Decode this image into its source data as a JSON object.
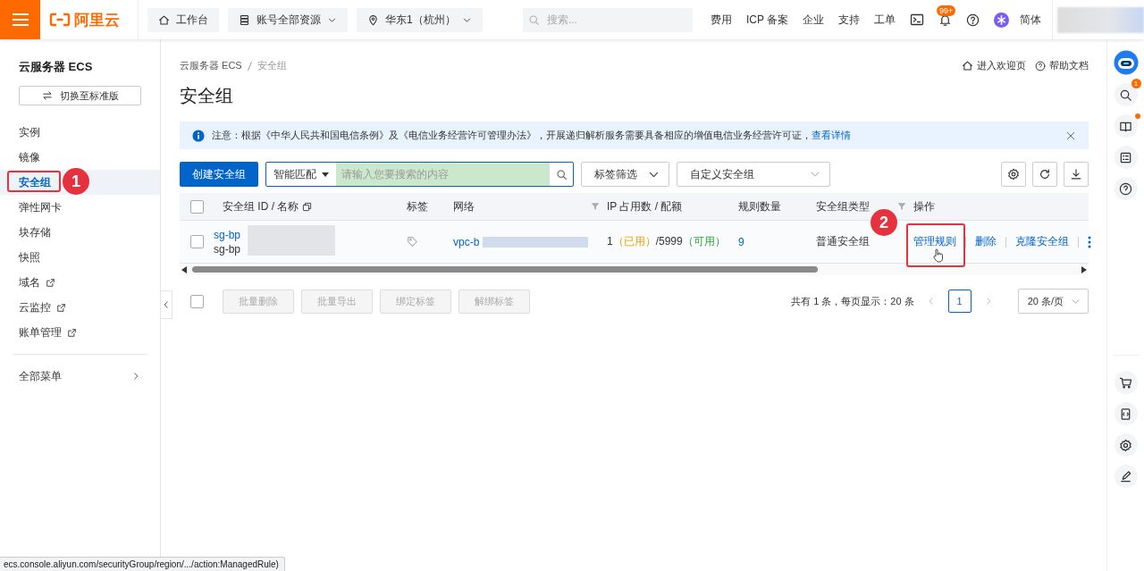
{
  "topbar": {
    "logo": "阿里云",
    "nav": [
      {
        "label": "工作台",
        "kind": "home"
      },
      {
        "label": "账号全部资源",
        "kind": "resources"
      },
      {
        "label": "华东1（杭州）",
        "kind": "region"
      }
    ],
    "search_placeholder": "搜索...",
    "links": [
      "费用",
      "ICP 备案",
      "企业",
      "支持",
      "工单"
    ],
    "notification_badge": "99+",
    "language": "简体"
  },
  "sidebar": {
    "title": "云服务器 ECS",
    "switch_button": "切换至标准版",
    "items": [
      {
        "label": "实例",
        "selected": false,
        "external": false
      },
      {
        "label": "镜像",
        "selected": false,
        "external": false
      },
      {
        "label": "安全组",
        "selected": true,
        "external": false,
        "callout": "1"
      },
      {
        "label": "弹性网卡",
        "selected": false,
        "external": false
      },
      {
        "label": "块存储",
        "selected": false,
        "external": false
      },
      {
        "label": "快照",
        "selected": false,
        "external": false
      },
      {
        "label": "域名",
        "selected": false,
        "external": true
      },
      {
        "label": "云监控",
        "selected": false,
        "external": true
      },
      {
        "label": "账单管理",
        "selected": false,
        "external": true
      }
    ],
    "all_menu": "全部菜单"
  },
  "breadcrumb": [
    "云服务器 ECS",
    "安全组"
  ],
  "page_title": "安全组",
  "header_links": [
    {
      "label": "进入欢迎页",
      "kind": "home"
    },
    {
      "label": "帮助文档",
      "kind": "help"
    }
  ],
  "notice": {
    "text": "注意：根据《中华人民共和国电信条例》及《电信业务经营许可管理办法》，开展递归解析服务需要具备相应的增值电信业务经营许可证，",
    "link": "查看详情"
  },
  "toolbar": {
    "create_button": "创建安全组",
    "search_mode": "智能匹配",
    "search_placeholder": "请输入您要搜索的内容",
    "tag_filter": "标签筛选",
    "group_filter": "自定义安全组"
  },
  "table": {
    "select_all_checked": false,
    "columns": [
      {
        "label": "安全组 ID / 名称",
        "copy": true
      },
      {
        "label": "标签"
      },
      {
        "label": "网络",
        "filter": true
      },
      {
        "label": "IP 占用数 / 配额"
      },
      {
        "label": "规则数量"
      },
      {
        "label": "安全组类型",
        "filter": true
      },
      {
        "label": "操作"
      }
    ],
    "rows": [
      {
        "checked": false,
        "id": "sg-bp",
        "name": "sg-bp",
        "network": "vpc-b",
        "ip_used": "1",
        "ip_used_label": "（已用）",
        "ip_quota": "/5999",
        "ip_quota_label": "（可用）",
        "rules": "9",
        "type": "普通安全组",
        "actions": [
          {
            "label": "管理规则",
            "highlighted": true,
            "callout": "2"
          },
          {
            "label": "删除"
          },
          {
            "label": "克隆安全组"
          }
        ]
      }
    ]
  },
  "bulk_actions": [
    {
      "label": "批量删除",
      "disabled": true
    },
    {
      "label": "批量导出",
      "disabled": true
    },
    {
      "label": "绑定标签",
      "disabled": true
    },
    {
      "label": "解绑标签",
      "disabled": true
    }
  ],
  "bulk_select_checked": false,
  "pagination": {
    "summary": "共有 1 条，每页显示：20 条",
    "pages": [
      {
        "label": "1",
        "selected": true
      }
    ],
    "page_size": "20 条/页"
  },
  "rightbar": {
    "search_badge": "1"
  },
  "status_url": "ecs.console.aliyun.com/securityGroup/region/.../action:ManagedRule)"
}
